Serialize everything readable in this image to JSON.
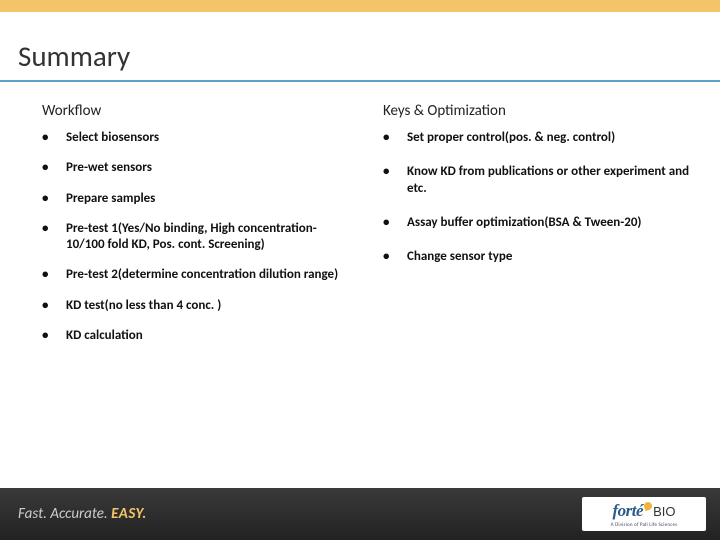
{
  "title": "Summary",
  "left": {
    "heading": "Workflow",
    "items": [
      "Select biosensors",
      "Pre-wet sensors",
      "Prepare samples",
      "Pre-test 1(Yes/No binding, High concentration-10/100 fold KD, Pos. cont. Screening)",
      "Pre-test 2(determine concentration dilution range)",
      "KD test(no less than 4 conc. )",
      "KD calculation"
    ]
  },
  "right": {
    "heading": "Keys & Optimization",
    "items": [
      "Set proper control(pos. & neg. control)",
      "Know KD from publications or other experiment and etc.",
      "Assay buffer optimization(BSA & Tween-20)",
      "Change sensor type"
    ]
  },
  "footer": {
    "tag1": "Fast.",
    "tag2": "Accurate.",
    "tag3": "EASY.",
    "logo_main": "forté",
    "logo_bio": "BIO",
    "logo_sub": "A Division of Pall Life Sciences"
  }
}
